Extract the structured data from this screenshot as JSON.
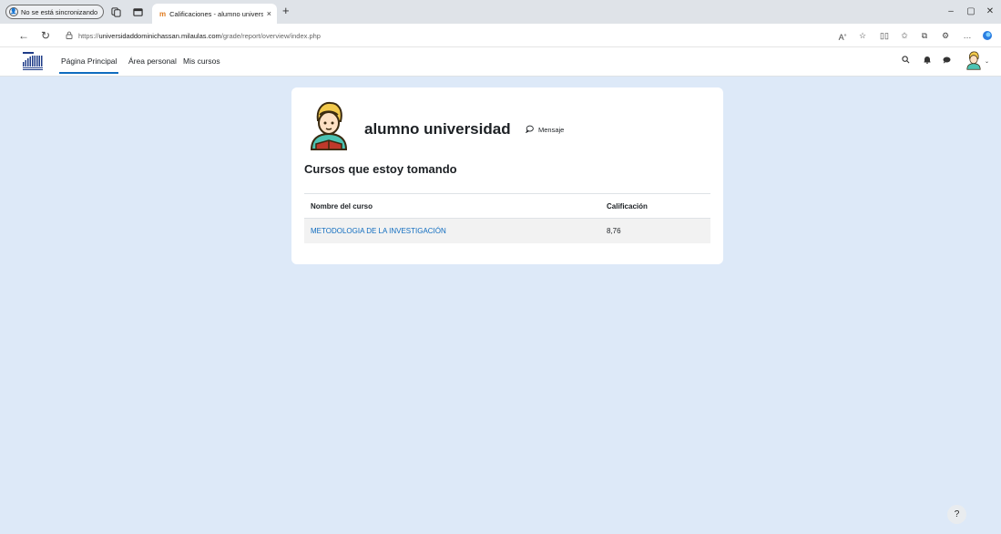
{
  "browser": {
    "profile_label": "No se está sincronizando",
    "tab_title": "Calificaciones - alumno universic",
    "tab_close": "×",
    "new_tab": "+",
    "url_prefix": "https://",
    "url_domain": "universidaddominichassan.milaulas.com",
    "url_path": "/grade/report/overview/index.php",
    "minimize": "–",
    "restore": "▢",
    "close": "✕"
  },
  "navbar": {
    "links": [
      "Página Principal",
      "Área personal",
      "Mis cursos"
    ],
    "active_index": 0
  },
  "profile": {
    "name": "alumno universidad",
    "message_label": "Mensaje"
  },
  "grades": {
    "title": "Cursos que estoy tomando",
    "columns": [
      "Nombre del curso",
      "Calificación"
    ],
    "rows": [
      {
        "course": "METODOLOGIA DE LA INVESTIGACIÓN",
        "grade": "8,76"
      }
    ]
  },
  "help": {
    "label": "?"
  },
  "colors": {
    "page_bg": "#dde9f8",
    "link": "#0f6cbf",
    "active_underline": "#0f6cbf"
  }
}
